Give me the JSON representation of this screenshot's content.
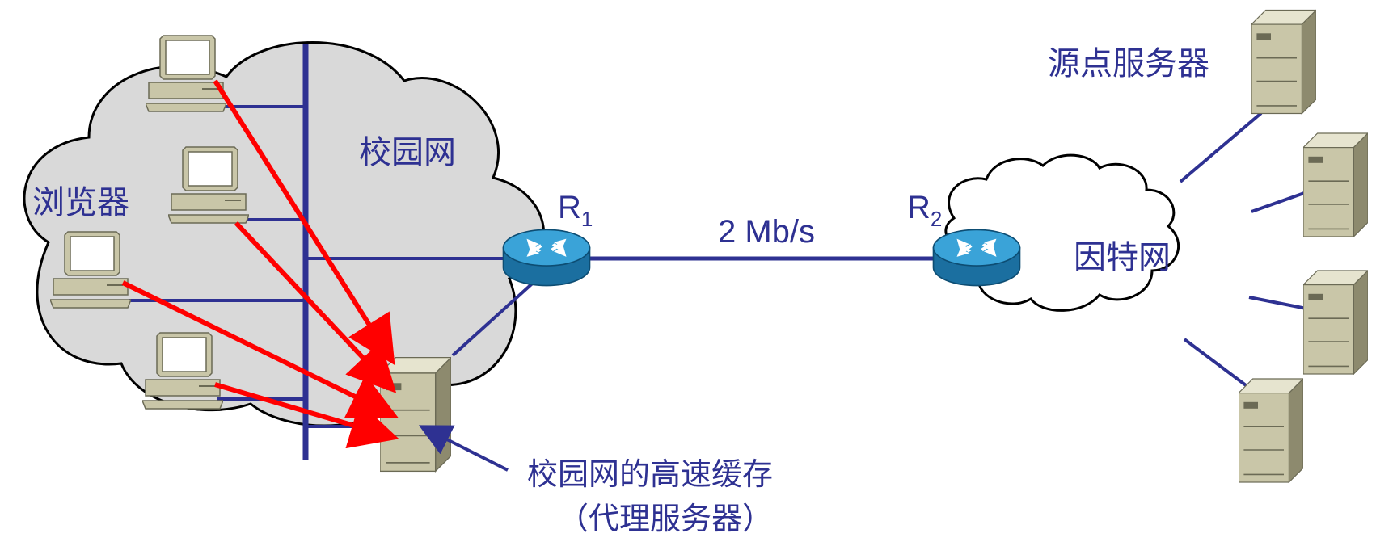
{
  "labels": {
    "browsers": "浏览器",
    "campus_network": "校园网",
    "router1_main": "R",
    "router1_sub": "1",
    "router2_main": "R",
    "router2_sub": "2",
    "link_speed": "2 Mb/s",
    "internet": "因特网",
    "origin_server": "源点服务器",
    "proxy_line1": "校园网的高速缓存",
    "proxy_line2": "（代理服务器）"
  },
  "colors": {
    "link": "#2e3192",
    "request_arrow": "#ff0000",
    "cloud_fill": "#d9d9d9",
    "internet_cloud_fill": "#ffffff",
    "router_top": "#3aa3d8",
    "router_side": "#1b6fa0",
    "server_body": "#c9c6a8",
    "text": "#2e3192"
  },
  "icons": {
    "computer": "desktop-computer-icon",
    "server": "tower-server-icon",
    "router": "router-icon"
  }
}
